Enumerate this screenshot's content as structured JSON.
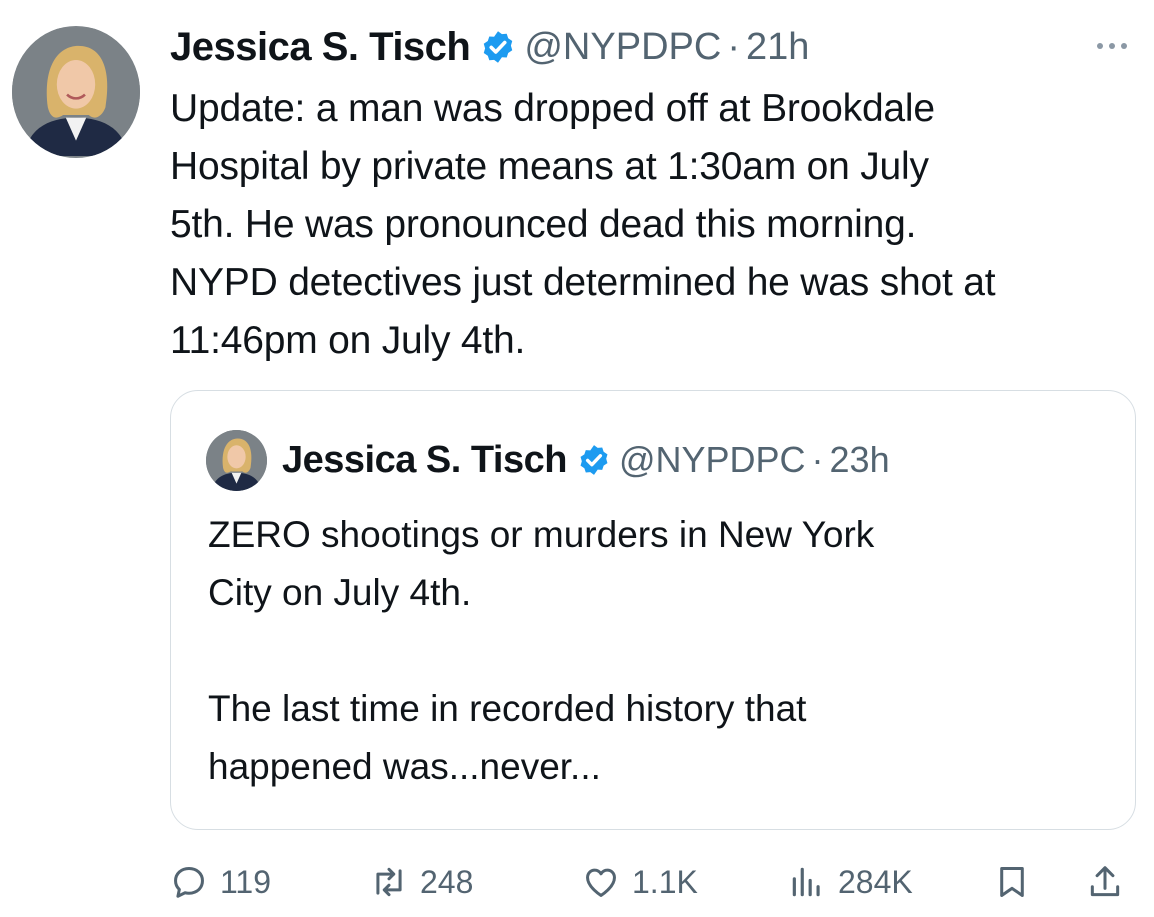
{
  "tweet": {
    "author_name": "Jessica S. Tisch",
    "handle": "@NYPDPC",
    "separator": "·",
    "time": "21h",
    "text_lines": [
      "Update: a man was dropped off at Brookdale",
      "Hospital by private means at 1:30am on July",
      "5th. He was pronounced dead this morning.",
      "NYPD detectives just determined he was shot at",
      "11:46pm on July 4th."
    ]
  },
  "quoted_tweet": {
    "author_name": "Jessica S. Tisch",
    "handle": "@NYPDPC",
    "separator": "·",
    "time": "23h",
    "paragraph1": [
      "ZERO shootings or murders in New York",
      "City on July 4th."
    ],
    "paragraph2": [
      "The last time in recorded history that",
      "happened was...never..."
    ]
  },
  "actions": {
    "replies": "119",
    "reposts": "248",
    "likes": "1.1K",
    "views": "284K"
  },
  "icons": {
    "verified_badge": "verified-check-icon",
    "more": "more-dots-icon",
    "reply": "reply-icon",
    "repost": "repost-icon",
    "like": "heart-icon",
    "views": "views-bar-chart-icon",
    "bookmark": "bookmark-icon",
    "share": "share-icon"
  },
  "colors": {
    "verified": "#1d9bf0",
    "secondary_text": "#536471",
    "border": "#d7dee3"
  }
}
